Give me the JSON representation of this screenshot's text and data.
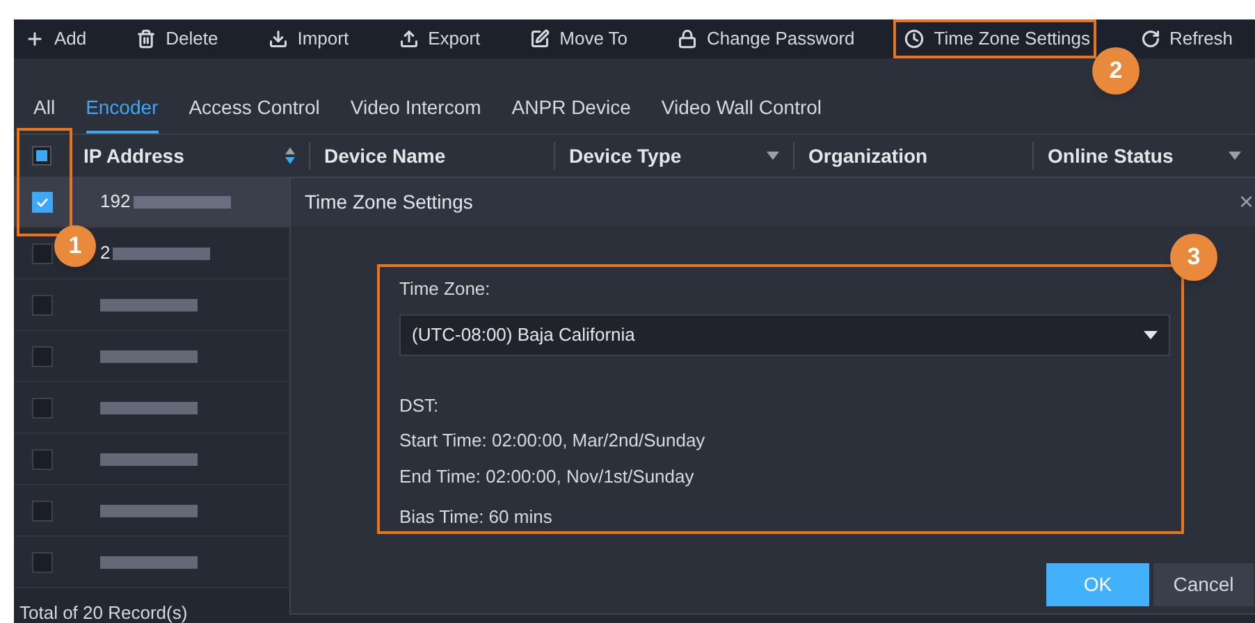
{
  "toolbar": [
    {
      "label": "Add"
    },
    {
      "label": "Delete"
    },
    {
      "label": "Import"
    },
    {
      "label": "Export"
    },
    {
      "label": "Move To"
    },
    {
      "label": "Change Password"
    },
    {
      "label": "Time Zone Settings"
    },
    {
      "label": "Refresh"
    }
  ],
  "tabs": [
    {
      "label": "All",
      "selected": false
    },
    {
      "label": "Encoder",
      "selected": true
    },
    {
      "label": "Access Control",
      "selected": false
    },
    {
      "label": "Video Intercom",
      "selected": false
    },
    {
      "label": "ANPR Device",
      "selected": false
    },
    {
      "label": "Video Wall Control",
      "selected": false
    }
  ],
  "table": {
    "header_checkbox": {
      "indeterminate": true
    },
    "columns": [
      {
        "label": "IP Address"
      },
      {
        "label": "Device Name"
      },
      {
        "label": "Device Type"
      },
      {
        "label": "Organization"
      },
      {
        "label": "Online Status"
      }
    ],
    "rows": [
      {
        "ip_prefix": "192",
        "checked": true,
        "selected": true
      },
      {
        "ip_prefix": "2",
        "checked": false,
        "selected": false
      },
      {
        "checked": false,
        "selected": false
      },
      {
        "checked": false,
        "selected": false
      },
      {
        "checked": false,
        "selected": false
      },
      {
        "checked": false,
        "selected": false
      },
      {
        "checked": false,
        "selected": false
      },
      {
        "checked": false,
        "selected": false
      }
    ],
    "footer": "Total of 20 Record(s)"
  },
  "dialog": {
    "title": "Time Zone Settings",
    "close": "×",
    "time_zone_label": "Time Zone:",
    "time_zone_value": "(UTC-08:00) Baja California",
    "dst_label": "DST:",
    "start_time": "Start Time: 02:00:00, Mar/2nd/Sunday",
    "end_time": "End Time: 02:00:00, Nov/1st/Sunday",
    "bias_time": "Bias Time: 60 mins",
    "buttons": [
      {
        "label": "OK",
        "kind": "primary"
      },
      {
        "label": "Cancel",
        "kind": "secondary"
      }
    ]
  },
  "callouts": [
    "1",
    "2",
    "3"
  ]
}
